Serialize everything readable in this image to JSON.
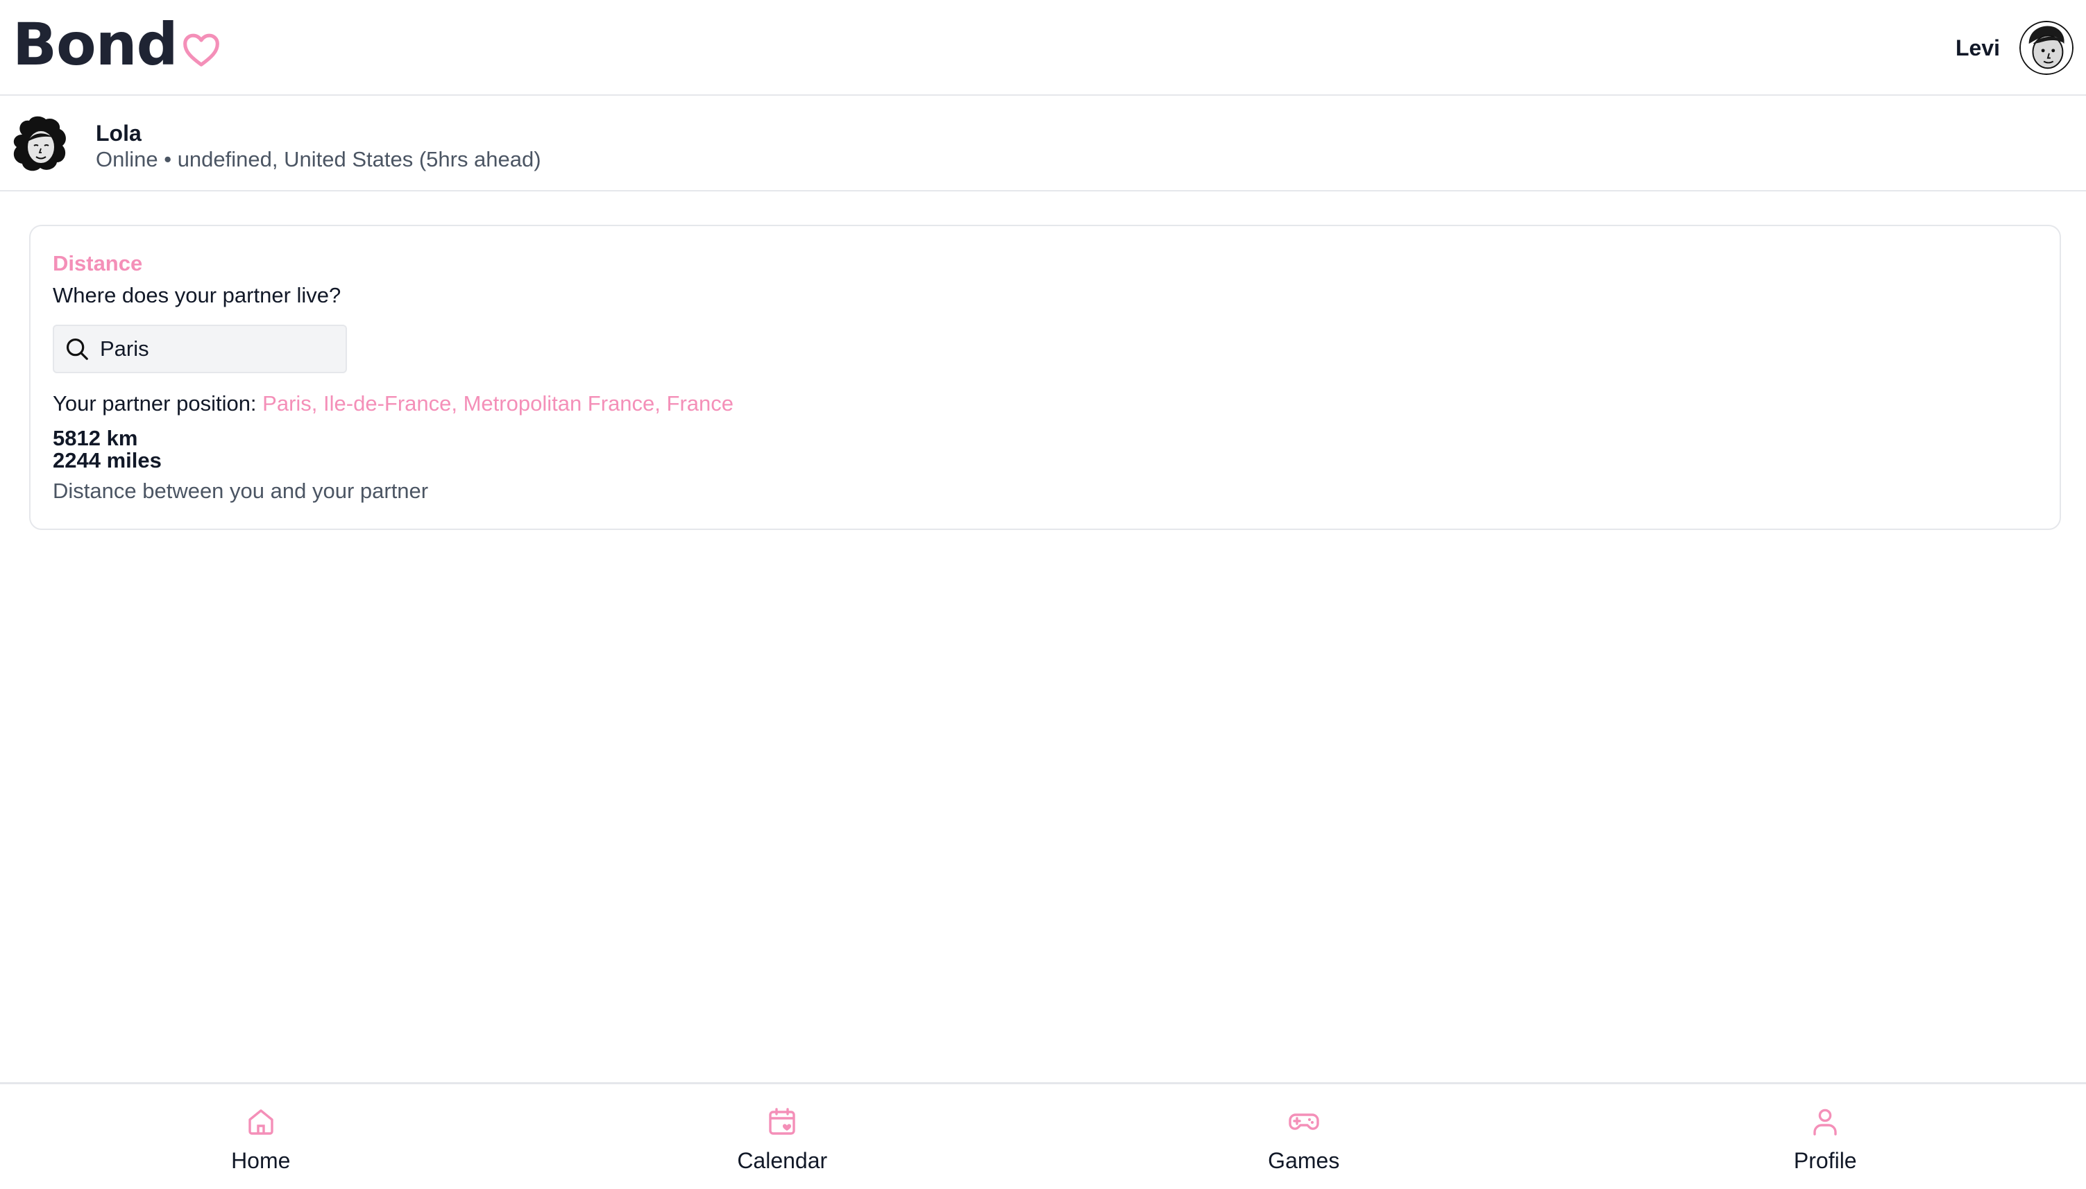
{
  "app": {
    "logo_text": "Bond",
    "accent_color": "#f48fb8"
  },
  "header": {
    "user_name": "Levi"
  },
  "partner": {
    "name": "Lola",
    "status": "Online • undefined, United States (5hrs ahead)"
  },
  "distance_card": {
    "title": "Distance",
    "question": "Where does your partner live?",
    "search_value": "Paris",
    "position_label": "Your partner position:",
    "position_value": "Paris, Ile-de-France, Metropolitan France, France",
    "distance_km": "5812 km",
    "distance_miles": "2244 miles",
    "caption": "Distance between you and your partner"
  },
  "nav": {
    "items": [
      {
        "label": "Home",
        "icon": "home-icon"
      },
      {
        "label": "Calendar",
        "icon": "calendar-icon"
      },
      {
        "label": "Games",
        "icon": "gamepad-icon"
      },
      {
        "label": "Profile",
        "icon": "user-icon"
      }
    ]
  }
}
